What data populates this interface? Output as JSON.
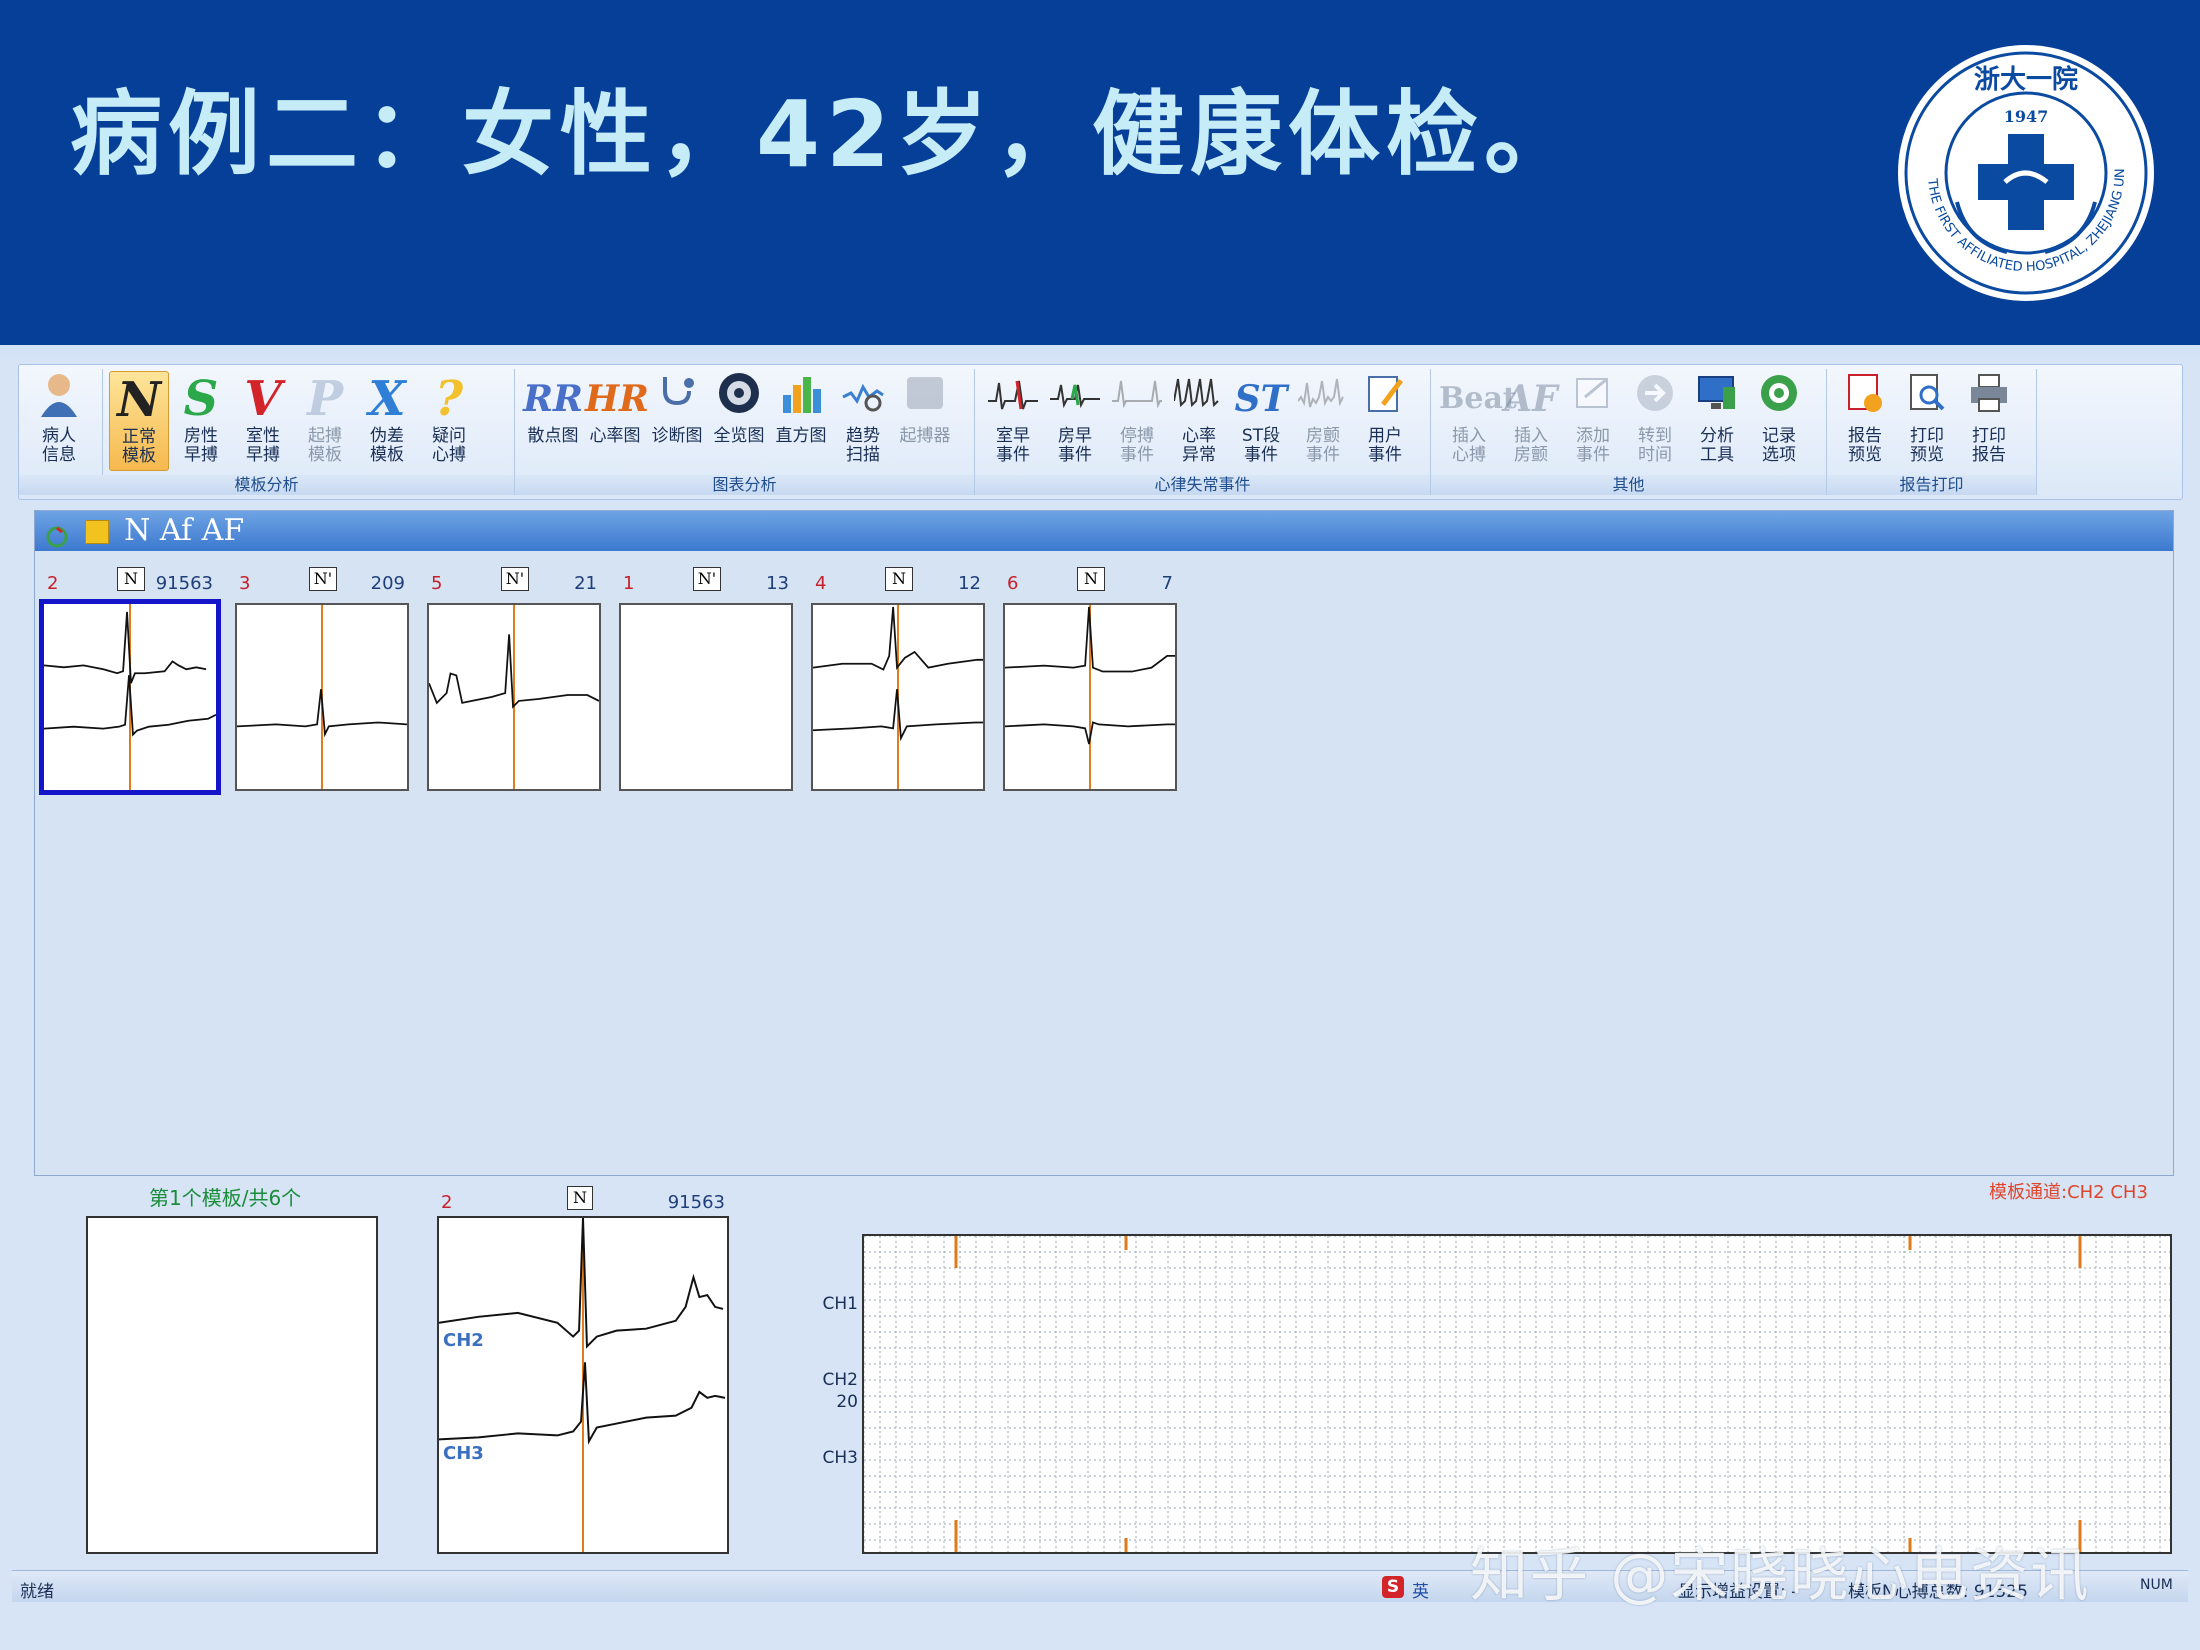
{
  "slide": {
    "title": "病例二：女性，42岁，健康体检。",
    "logo": {
      "top_text": "浙大一院",
      "year": "1947",
      "ring_text": "THE FIRST AFFILIATED HOSPITAL, ZHEJIANG UNIVERSITY"
    }
  },
  "ribbon": {
    "groups": [
      {
        "label": "模板分析",
        "buttons": [
          {
            "label": "病人\n信息",
            "icon": "patient-icon"
          },
          {
            "label": "正常\n模板",
            "glyph": "N",
            "active": true
          },
          {
            "label": "房性\n早搏",
            "glyph": "S"
          },
          {
            "label": "室性\n早搏",
            "glyph": "V"
          },
          {
            "label": "起搏\n模板",
            "glyph": "P",
            "disabled": true
          },
          {
            "label": "伪差\n模板",
            "glyph": "X"
          },
          {
            "label": "疑问\n心搏",
            "glyph": "?"
          }
        ]
      },
      {
        "label": "图表分析",
        "buttons": [
          {
            "label": "散点图",
            "glyph": "RR"
          },
          {
            "label": "心率图",
            "glyph": "HR"
          },
          {
            "label": "诊断图",
            "icon": "stethoscope-icon"
          },
          {
            "label": "全览图",
            "icon": "disc-icon"
          },
          {
            "label": "直方图",
            "icon": "histogram-icon"
          },
          {
            "label": "趋势\n扫描",
            "icon": "trend-icon"
          },
          {
            "label": "起搏器",
            "icon": "pacemaker-icon",
            "disabled": true
          }
        ]
      },
      {
        "label": "心律失常事件",
        "buttons": [
          {
            "label": "室早\n事件"
          },
          {
            "label": "房早\n事件"
          },
          {
            "label": "停搏\n事件",
            "disabled": true
          },
          {
            "label": "心率\n异常"
          },
          {
            "label": "ST段\n事件",
            "glyph": "ST"
          },
          {
            "label": "房颤\n事件",
            "disabled": true
          },
          {
            "label": "用户\n事件"
          }
        ]
      },
      {
        "label": "其他",
        "buttons": [
          {
            "label": "插入\n心搏",
            "glyph": "Beat",
            "disabled": true
          },
          {
            "label": "插入\n房颤",
            "glyph": "AF",
            "disabled": true
          },
          {
            "label": "添加\n事件",
            "disabled": true
          },
          {
            "label": "转到\n时间",
            "disabled": true
          },
          {
            "label": "分析\n工具"
          },
          {
            "label": "记录\n选项"
          }
        ]
      },
      {
        "label": "报告打印",
        "buttons": [
          {
            "label": "报告\n预览"
          },
          {
            "label": "打印\n预览"
          },
          {
            "label": "打印\n报告"
          }
        ]
      }
    ]
  },
  "template_panel": {
    "toolbar_text": "N Af AF",
    "templates": [
      {
        "index": "2",
        "label": "N",
        "count": "91563",
        "selected": true
      },
      {
        "index": "3",
        "label": "N'",
        "count": "209"
      },
      {
        "index": "5",
        "label": "N'",
        "count": "21"
      },
      {
        "index": "1",
        "label": "N'",
        "count": "13"
      },
      {
        "index": "4",
        "label": "N",
        "count": "12"
      },
      {
        "index": "6",
        "label": "N",
        "count": "7"
      }
    ]
  },
  "bottom": {
    "caption": "第1个模板/共6个",
    "detail": {
      "index": "2",
      "label": "N",
      "count": "91563",
      "ch_a": "CH2",
      "ch_b": "CH3"
    },
    "channels_label": "模板通道:CH2   CH3",
    "strip_labels": {
      "ch1": "CH1",
      "ch2": "CH2",
      "gain": "20",
      "ch3": "CH3"
    }
  },
  "status": {
    "ready": "就绪",
    "ime": "英",
    "gain": "显示增益设置: -",
    "total": "模板N心搏总数: 91525",
    "num": "NUM"
  },
  "watermark": "知乎 @宋晓晓心电资讯",
  "colors": {
    "header": "#063f98",
    "title": "#c6ecf8",
    "accent": "#1414c8",
    "marker": "#e07a1a"
  }
}
